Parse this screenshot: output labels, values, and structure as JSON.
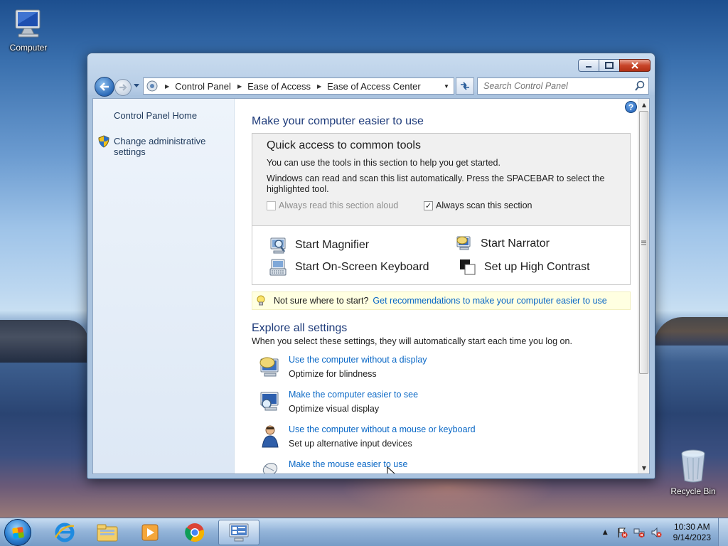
{
  "desktop": {
    "icons": [
      {
        "label": "Computer"
      },
      {
        "label": "Recycle Bin"
      }
    ]
  },
  "window": {
    "address": {
      "crumbs": [
        "Control Panel",
        "Ease of Access",
        "Ease of Access Center"
      ]
    },
    "search": {
      "placeholder": "Search Control Panel"
    },
    "sidebar": {
      "home": "Control Panel Home",
      "admin": "Change administrative settings"
    },
    "main": {
      "title": "Make your computer easier to use",
      "quick": {
        "title": "Quick access to common tools",
        "line1": "You can use the tools in this section to help you get started.",
        "line2": "Windows can read and scan this list automatically.  Press the SPACEBAR to select the highlighted tool.",
        "read_aloud": "Always read this section aloud",
        "read_aloud_checked": false,
        "scan": "Always scan this section",
        "scan_checked": true,
        "tools": [
          "Start Magnifier",
          "Start Narrator",
          "Start On-Screen Keyboard",
          "Set up High Contrast"
        ]
      },
      "tip": {
        "label": "Not sure where to start?",
        "link": "Get recommendations to make your computer easier to use"
      },
      "explore": {
        "title": "Explore all settings",
        "subtitle": "When you select these settings, they will automatically start each time you log on.",
        "items": [
          {
            "link": "Use the computer without a display",
            "desc": "Optimize for blindness"
          },
          {
            "link": "Make the computer easier to see",
            "desc": "Optimize visual display"
          },
          {
            "link": "Use the computer without a mouse or keyboard",
            "desc": "Set up alternative input devices"
          },
          {
            "link": "Make the mouse easier to use",
            "desc": ""
          }
        ]
      }
    }
  },
  "taskbar": {
    "clock": {
      "time": "10:30 AM",
      "date": "9/14/2023"
    }
  },
  "colors": {
    "link": "#0a68c6",
    "heading": "#1e3b7a",
    "tip_bg": "#ffffe1"
  }
}
